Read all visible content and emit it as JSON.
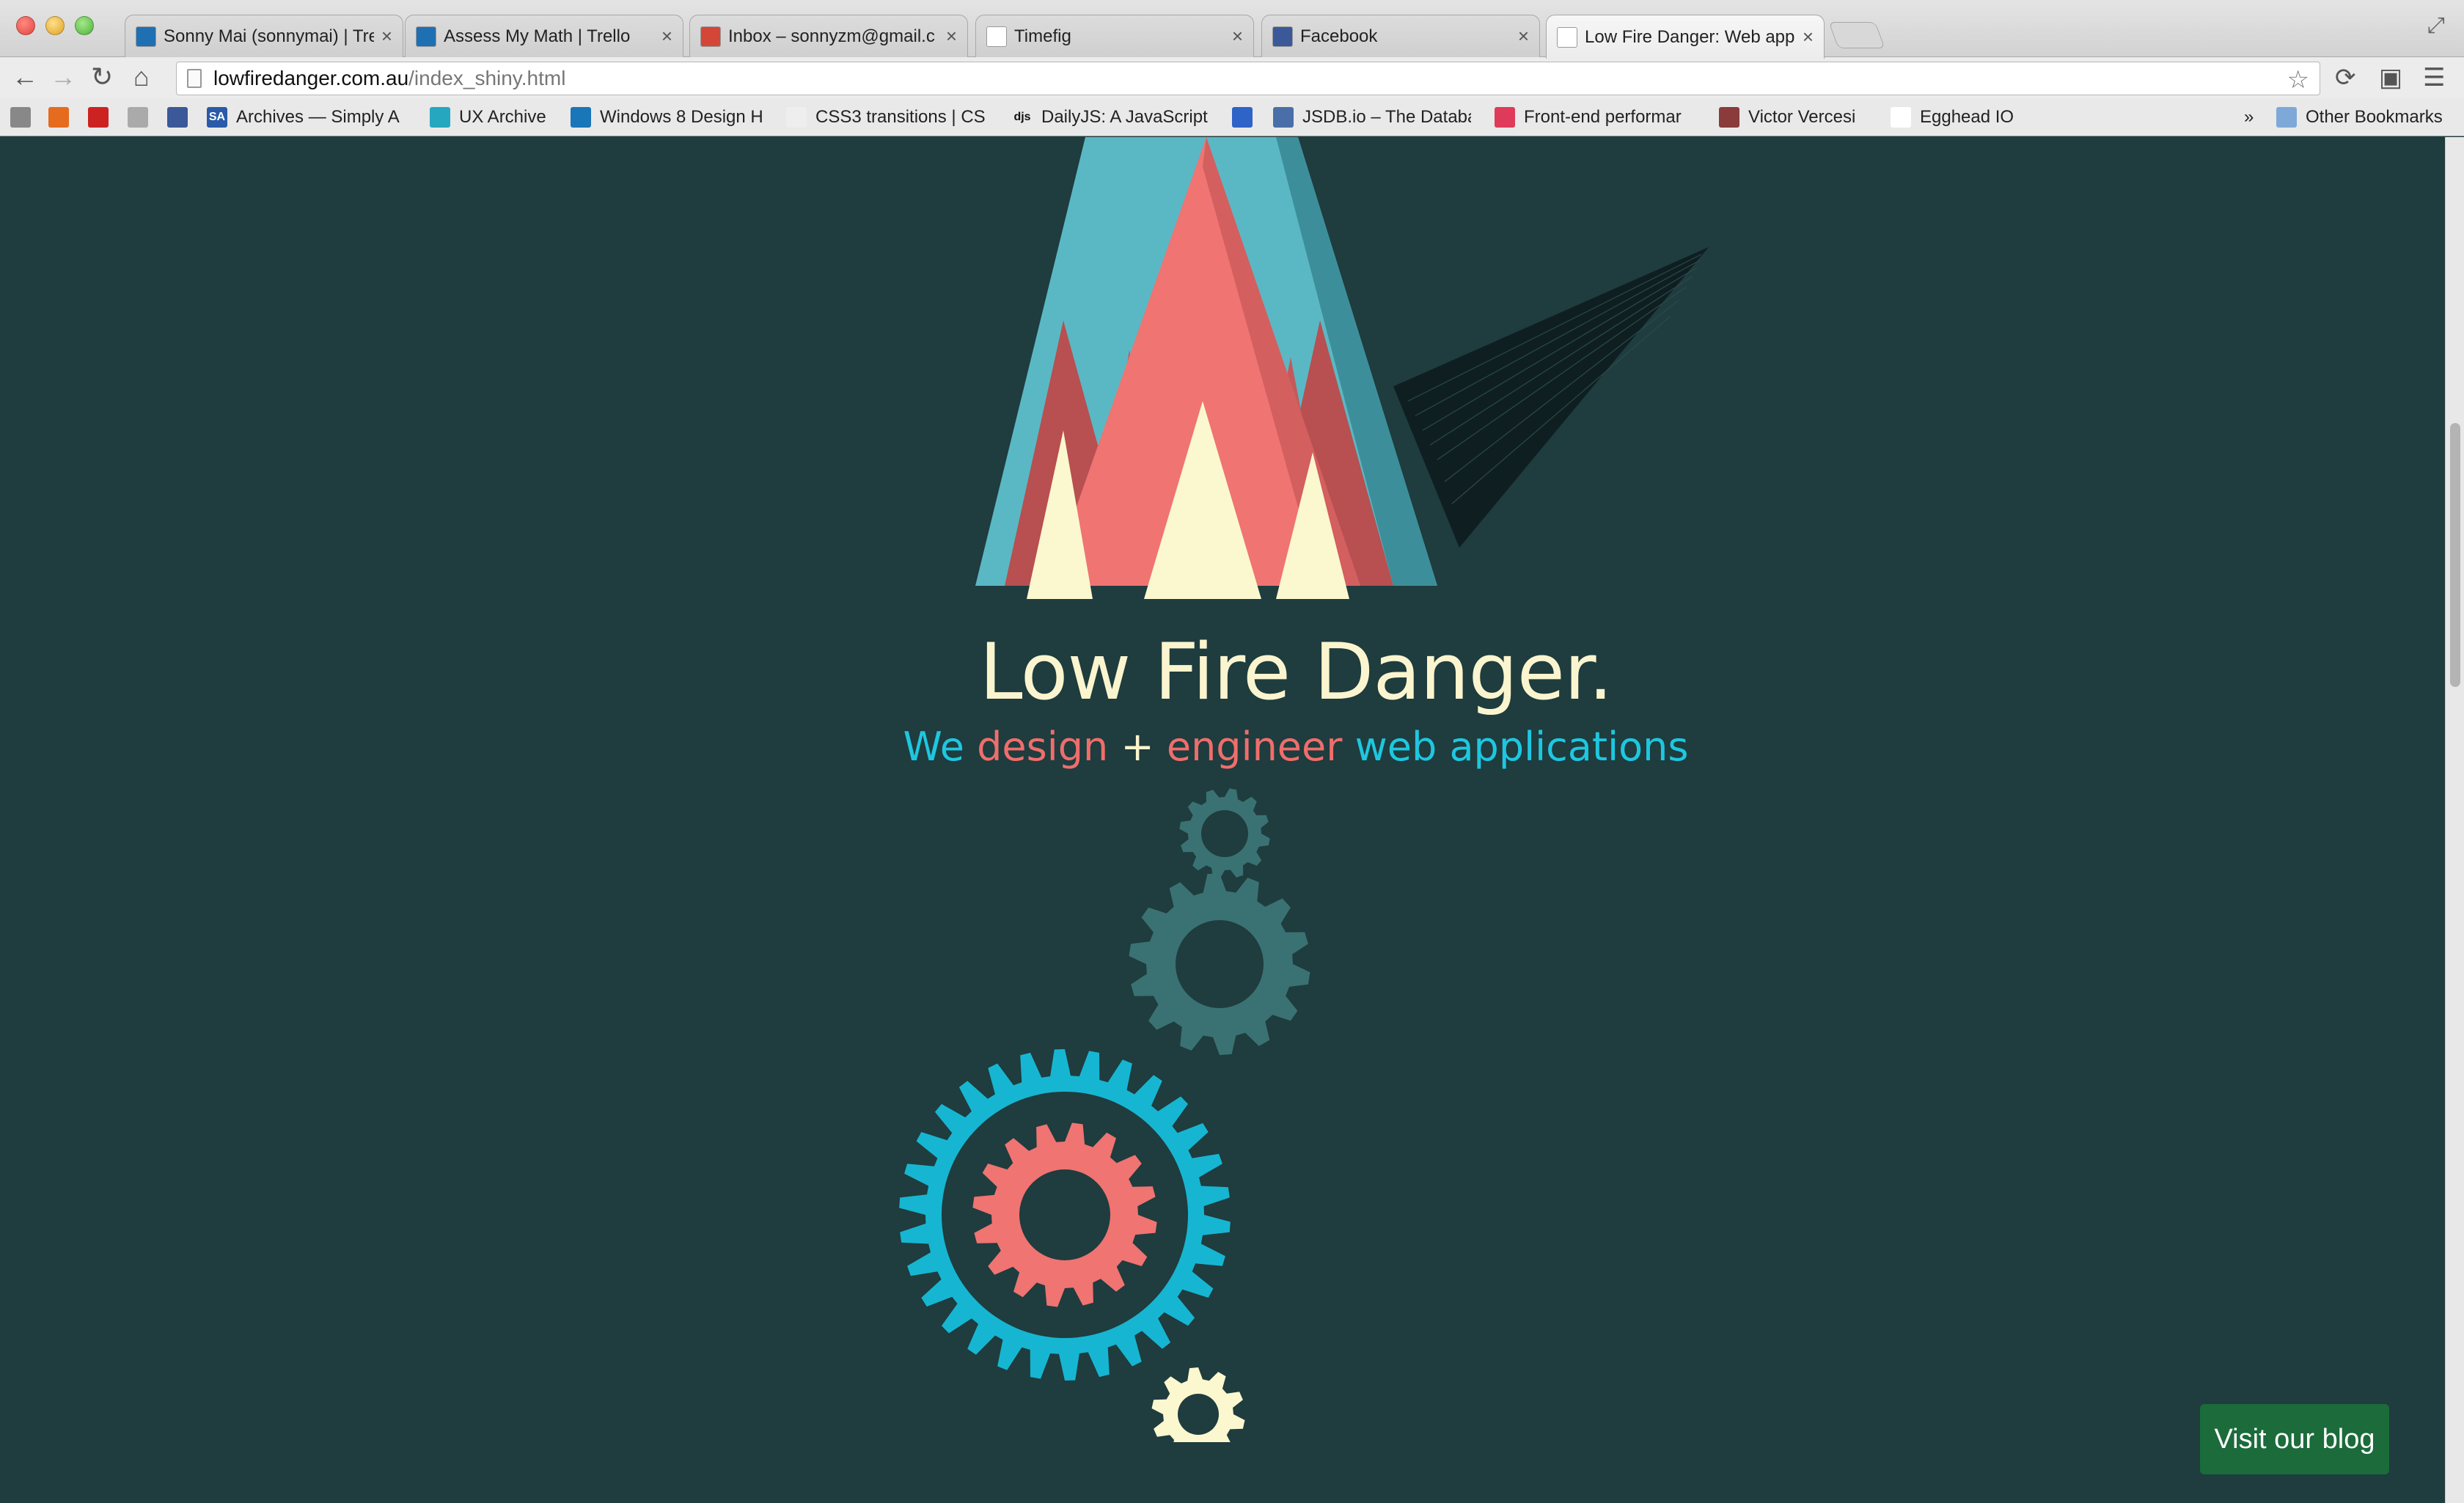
{
  "browser": {
    "tabs": [
      {
        "title": "Sonny Mai (sonnymai) | Tre",
        "favicon": "trello-icon",
        "color": "#1f6fb3",
        "active": false
      },
      {
        "title": "Assess My Math | Trello",
        "favicon": "trello-icon",
        "color": "#1f6fb3",
        "active": false
      },
      {
        "title": "Inbox – sonnyzm@gmail.c",
        "favicon": "gmail-icon",
        "color": "#d44638",
        "active": false
      },
      {
        "title": "Timefig",
        "favicon": "page-icon",
        "color": "#ffffff",
        "active": false
      },
      {
        "title": "Facebook",
        "favicon": "facebook-icon",
        "color": "#3b5998",
        "active": false
      },
      {
        "title": "Low Fire Danger: Web appl",
        "favicon": "page-icon",
        "color": "#ffffff",
        "active": true
      }
    ],
    "tab_close": "×",
    "url_host": "lowfiredanger.com.au",
    "url_path": "/index_shiny.html",
    "bookmarks": [
      {
        "label": "",
        "icon": "bookmark-app-icon",
        "color": "#888888"
      },
      {
        "label": "",
        "icon": "bookmark-w-icon",
        "color": "#e56b1f"
      },
      {
        "label": "",
        "icon": "bookmark-bird-icon",
        "color": "#cc2222"
      },
      {
        "label": "",
        "icon": "bookmark-grey-icon",
        "color": "#aaaaaa"
      },
      {
        "label": "",
        "icon": "facebook-icon",
        "color": "#3b5998"
      },
      {
        "label": "Archives — Simply A",
        "icon": "sa-icon",
        "color": "#2a5aa8",
        "text": "SA"
      },
      {
        "label": "UX Archive",
        "icon": "ux-archive-icon",
        "color": "#26a7c0"
      },
      {
        "label": "Windows 8 Design H",
        "icon": "windows-icon",
        "color": "#1976b9"
      },
      {
        "label": "CSS3 transitions | CS",
        "icon": "css3-icon",
        "color": "#eeeeee"
      },
      {
        "label": "DailyJS: A JavaScript",
        "icon": "djs-icon",
        "color": "#e9e9e9",
        "text": "djs"
      },
      {
        "label": "",
        "icon": "blue-folder-icon",
        "color": "#2e63c7"
      },
      {
        "label": "JSDB.io – The Databa",
        "icon": "jsdb-icon",
        "color": "#4a6fa8"
      },
      {
        "label": "Front-end performar",
        "icon": "css-red-icon",
        "color": "#e03a5a"
      },
      {
        "label": "Victor Vercesi",
        "icon": "shield-icon",
        "color": "#8a3b3b"
      },
      {
        "label": "Egghead IO",
        "icon": "page-icon",
        "color": "#ffffff"
      }
    ],
    "overflow": "»",
    "other_bookmarks": "Other Bookmarks"
  },
  "page": {
    "title": "Low Fire Danger.",
    "tagline": {
      "w1": "We",
      "w2": "design",
      "w3": "+",
      "w4": "engineer",
      "w5": "web applications"
    },
    "blog_button": "Visit our blog"
  },
  "colors": {
    "background": "#1f3c3e",
    "teal": "#5ab8c4",
    "teal_dark": "#3c8f9a",
    "coral": "#ef7472",
    "coral_dark": "#b84f50",
    "cream": "#fbf7cf",
    "gear_blue": "#16b6d2",
    "gear_faint": "#3a7273",
    "button": "#1b6b3b"
  }
}
